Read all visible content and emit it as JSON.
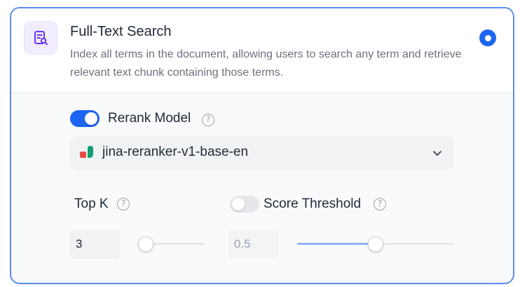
{
  "method": {
    "title": "Full-Text Search",
    "description": "Index all terms in the document, allowing users to search any term and retrieve relevant text chunk containing those terms.",
    "icon": "full-text-search-icon",
    "selected": true
  },
  "rerank": {
    "enabled": true,
    "label": "Rerank Model",
    "help_icon": "?",
    "model": "jina-reranker-v1-base-en"
  },
  "top_k": {
    "label": "Top K",
    "help_icon": "?",
    "value": "3",
    "level": 0.12
  },
  "score_threshold": {
    "enabled": false,
    "label": "Score Threshold",
    "help_icon": "?",
    "value": "0.5",
    "level": 0.5
  },
  "colors": {
    "accent": "#1c64f2",
    "border": "#5b8def",
    "icon_purple": "#6938ef"
  }
}
